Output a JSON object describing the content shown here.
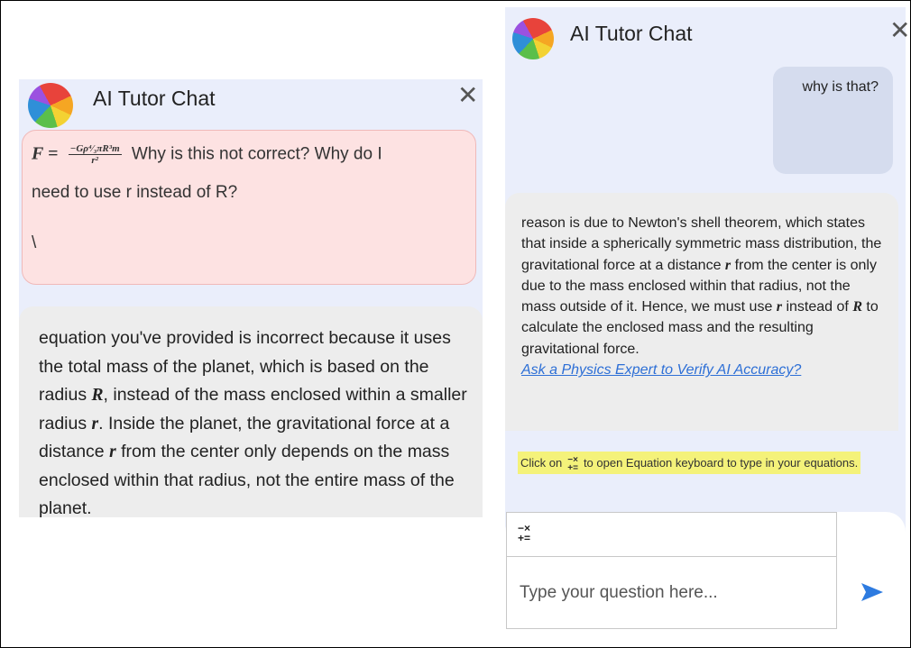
{
  "left_panel": {
    "title": "AI Tutor Chat",
    "close_glyph": "✕",
    "user_message": {
      "formula_lhs": "F =",
      "formula_num": "−Gρ⁴⁄₃πR³m",
      "formula_den": "r²",
      "text_line1": "Why is this not correct?  Why do I",
      "text_line2": "need to use r instead of R?",
      "text_line3": "\\"
    },
    "ai_message": {
      "t1": "equation you've provided is incorrect because it uses the total mass of the planet, which is based on the radius ",
      "var_R": "R",
      "t2": ", instead of the mass enclosed within a smaller radius ",
      "var_r1": "r",
      "t3": ". Inside the planet, the gravitational force at a distance ",
      "var_r2": "r",
      "t4": " from the center only depends on the mass enclosed within that radius, not the entire mass of the planet."
    }
  },
  "right_panel": {
    "title": "AI Tutor Chat",
    "close_glyph": "✕",
    "user_message": "why is that?",
    "ai_message": {
      "t1": "reason is due to Newton's shell theorem, which states that inside a spherically symmetric mass distribution, the gravitational force at a distance ",
      "var_r1": "r",
      "t2": " from the center is only due to the mass enclosed within that radius, not the mass outside of it. Hence, we must use ",
      "var_r2": "r",
      "t3": " instead of ",
      "var_R": "R",
      "t4": " to calculate the enclosed mass and the resulting gravitational force.",
      "link": "Ask a Physics Expert to Verify AI Accuracy?"
    },
    "hint": {
      "before": "Click on",
      "icon_top": "−×",
      "icon_bottom": "+=",
      "after": "to open Equation keyboard to type in your equations."
    },
    "equation_button": {
      "top": "−×",
      "bottom": "+="
    },
    "input_placeholder": "Type your question here...",
    "send_icon": "send-arrow-icon"
  },
  "colors": {
    "panel_bg": "#eaeefb",
    "user_bubble_left": "#fde2e2",
    "user_bubble_right": "#d5dcee",
    "ai_bubble": "#ededed",
    "link": "#2d6fd6",
    "highlight": "#f4f27a",
    "send": "#2d7be0"
  }
}
